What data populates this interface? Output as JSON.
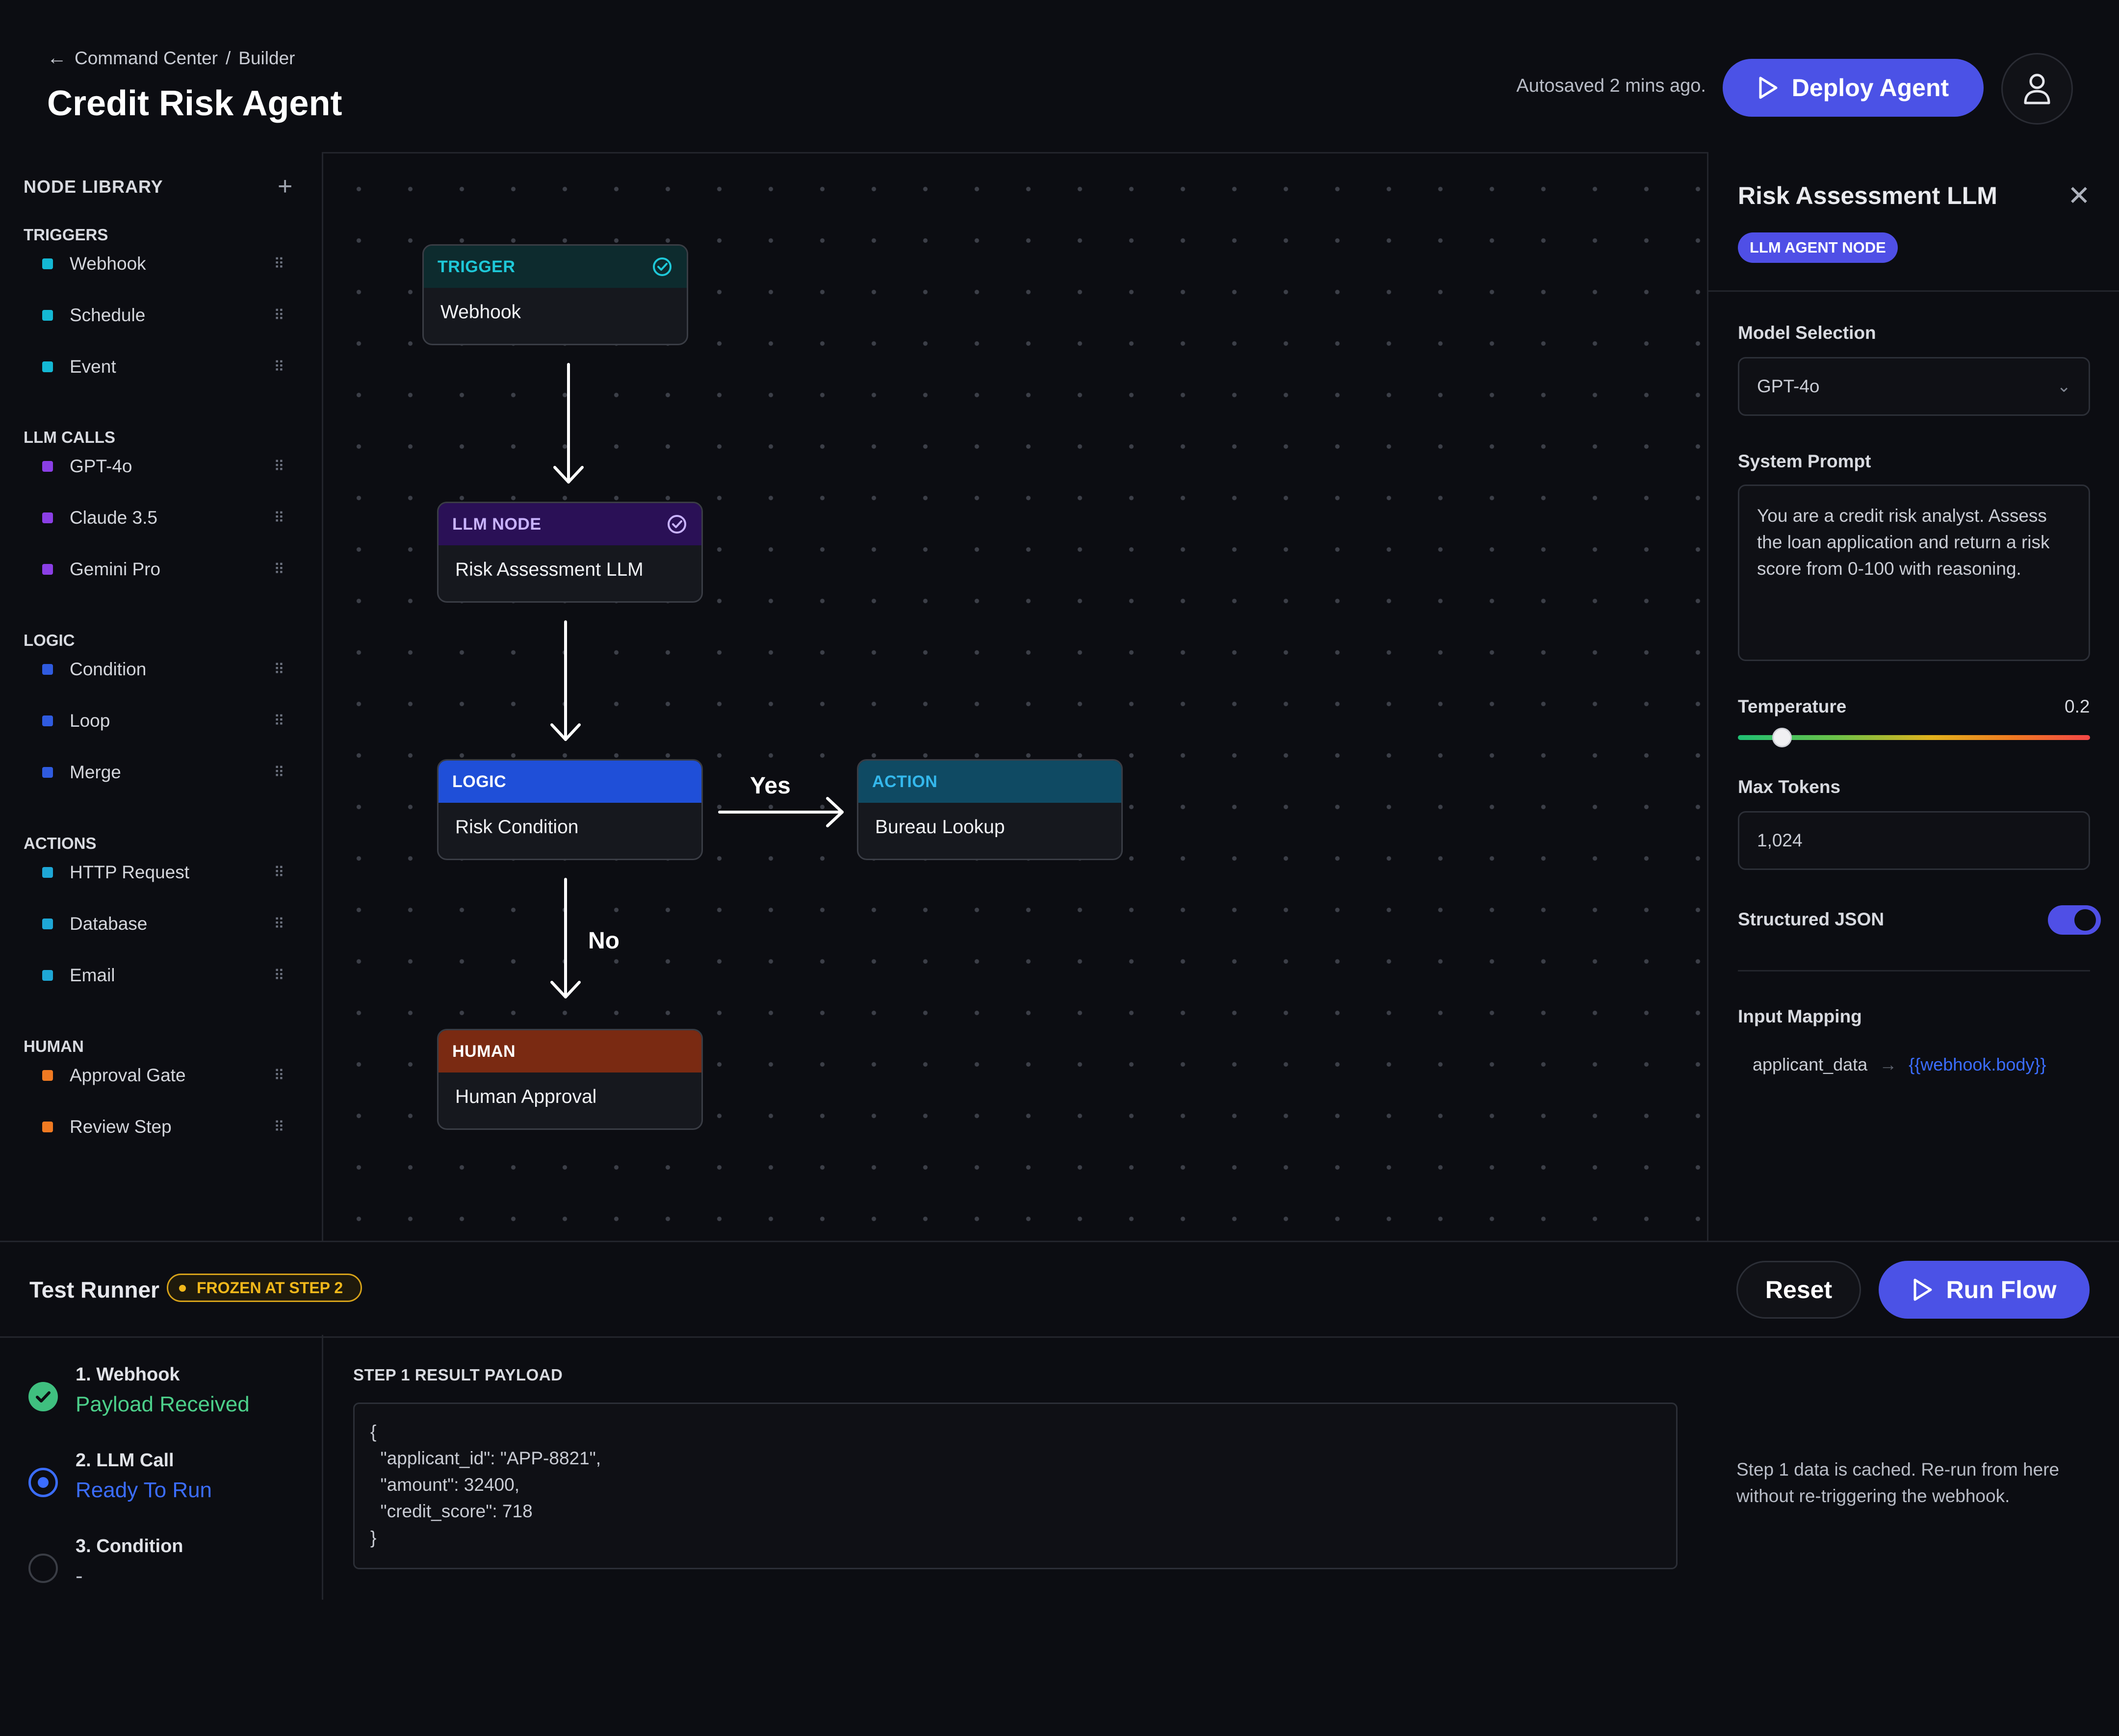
{
  "header": {
    "breadcrumb_root": "Command Center",
    "breadcrumb_sep": "/",
    "breadcrumb_current": "Builder",
    "title": "Credit Risk Agent",
    "autosave": "Autosaved 2 mins ago.",
    "deploy_label": "Deploy Agent"
  },
  "sidebar": {
    "title": "NODE LIBRARY",
    "groups": [
      {
        "title": "TRIGGERS",
        "color": "#14b8d4",
        "items": [
          "Webhook",
          "Schedule",
          "Event"
        ]
      },
      {
        "title": "LLM CALLS",
        "color": "#8b3fe6",
        "items": [
          "GPT-4o",
          "Claude 3.5",
          "Gemini Pro"
        ]
      },
      {
        "title": "LOGIC",
        "color": "#2f5be0",
        "items": [
          "Condition",
          "Loop",
          "Merge"
        ]
      },
      {
        "title": "ACTIONS",
        "color": "#1ea7d6",
        "items": [
          "HTTP Request",
          "Database",
          "Email"
        ]
      },
      {
        "title": "HUMAN",
        "color": "#f07a22",
        "items": [
          "Approval Gate",
          "Review Step"
        ]
      }
    ]
  },
  "canvas": {
    "nodes": [
      {
        "type": "TRIGGER",
        "label": "Webhook",
        "head_bg": "#0d2b2e",
        "head_color": "#1ec8d8",
        "check": true
      },
      {
        "type": "LLM NODE",
        "label": "Risk Assessment LLM",
        "head_bg": "#2a1056",
        "head_color": "#c9b3ff",
        "check": true
      },
      {
        "type": "LOGIC",
        "label": "Risk Condition",
        "head_bg": "#1f4fd8",
        "head_color": "#ffffff",
        "check": false
      },
      {
        "type": "ACTION",
        "label": "Bureau Lookup",
        "head_bg": "#0f4a63",
        "head_color": "#34b8ec",
        "check": false
      },
      {
        "type": "HUMAN",
        "label": "Human Approval",
        "head_bg": "#7a2a12",
        "head_color": "#ffffff",
        "check": false
      }
    ],
    "edge_yes": "Yes",
    "edge_no": "No"
  },
  "panel": {
    "title": "Risk Assessment LLM",
    "badge": "LLM AGENT NODE",
    "model_label": "Model Selection",
    "model_value": "GPT-4o",
    "prompt_label": "System Prompt",
    "prompt_value": "You are a credit risk analyst. Assess the loan application and return a risk score from 0-100 with reasoning.",
    "temperature_label": "Temperature",
    "temperature_value": "0.2",
    "temperature_fraction": 0.2,
    "max_tokens_label": "Max Tokens",
    "max_tokens_value": "1,024",
    "json_label": "Structured JSON",
    "json_enabled": true,
    "mapping_label": "Input Mapping",
    "mapping_source": "applicant_data",
    "mapping_target": "{{webhook.body}}"
  },
  "runner": {
    "title": "Test Runner",
    "frozen_badge": "FROZEN AT STEP 2",
    "reset_label": "Reset",
    "run_label": "Run Flow",
    "steps": [
      {
        "name": "1. Webhook",
        "status": "Payload Received",
        "state": "done"
      },
      {
        "name": "2. LLM Call",
        "status": "Ready To Run",
        "state": "ready"
      },
      {
        "name": "3. Condition",
        "status": "-",
        "state": "pending"
      }
    ],
    "payload_title": "STEP 1 RESULT PAYLOAD",
    "payload": "{\n  \"applicant_id\": \"APP-8821\",\n  \"amount\": 32400,\n  \"credit_score\": 718\n}",
    "cache_note": "Step 1 data is cached. Re-run from here without re-triggering the webhook."
  }
}
